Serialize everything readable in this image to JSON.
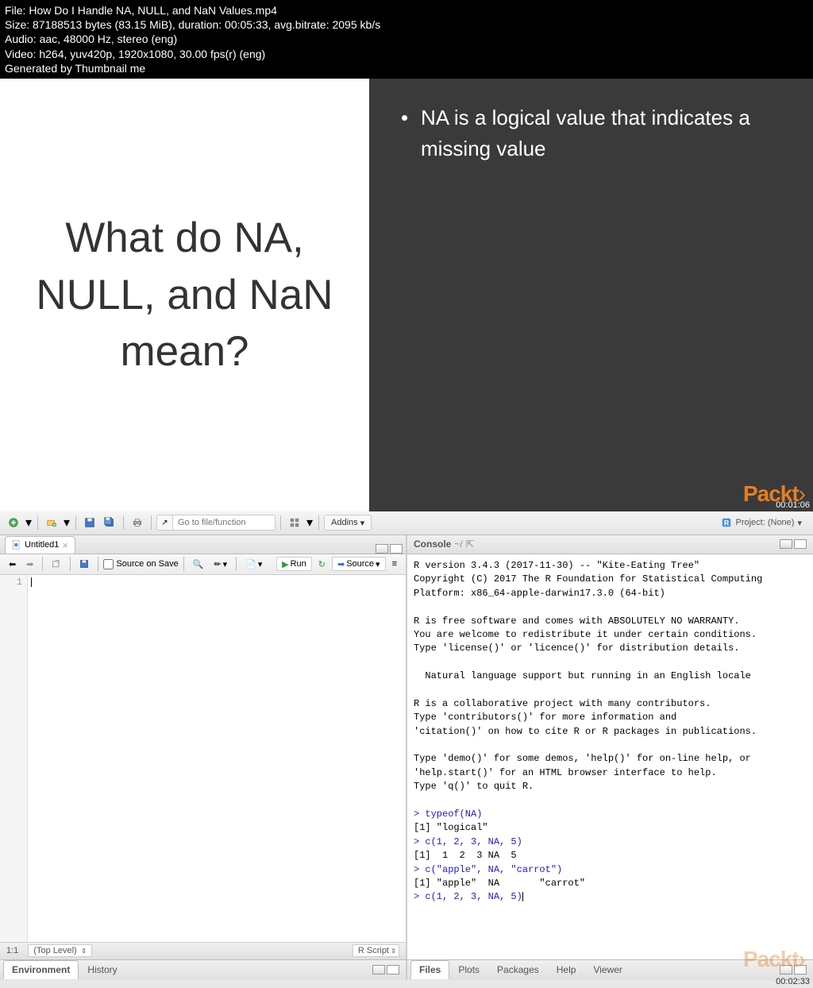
{
  "file_info": {
    "line1": "File: How Do I Handle NA, NULL, and NaN Values.mp4",
    "line2": "Size: 87188513 bytes (83.15 MiB), duration: 00:05:33, avg.bitrate: 2095 kb/s",
    "line3": "Audio: aac, 48000 Hz, stereo (eng)",
    "line4": "Video: h264, yuv420p, 1920x1080, 30.00 fps(r) (eng)",
    "line5": "Generated by Thumbnail me"
  },
  "slide": {
    "question": "What do NA, NULL, and NaN mean?",
    "bullet1": "NA is a logical value that indicates a missing value",
    "brand": "Packt",
    "ts1": "00:01:06"
  },
  "rstudio": {
    "toolbar": {
      "goto_placeholder": "Go to file/function",
      "addins": "Addins",
      "project": "Project: (None)"
    },
    "source": {
      "tab_title": "Untitled1",
      "source_on_save": "Source on Save",
      "run": "Run",
      "source_btn": "Source",
      "line1": "1",
      "status_pos": "1:1",
      "status_scope": "(Top Level)",
      "status_lang": "R Script"
    },
    "console": {
      "title": "Console",
      "path": "~/",
      "text_block1": "R version 3.4.3 (2017-11-30) -- \"Kite-Eating Tree\"\nCopyright (C) 2017 The R Foundation for Statistical Computing\nPlatform: x86_64-apple-darwin17.3.0 (64-bit)\n\nR is free software and comes with ABSOLUTELY NO WARRANTY.\nYou are welcome to redistribute it under certain conditions.\nType 'license()' or 'licence()' for distribution details.\n\n  Natural language support but running in an English locale\n\nR is a collaborative project with many contributors.\nType 'contributors()' for more information and\n'citation()' on how to cite R or R packages in publications.\n\nType 'demo()' for some demos, 'help()' for on-line help, or\n'help.start()' for an HTML browser interface to help.\nType 'q()' to quit R.\n",
      "cmd1": "> typeof(NA)",
      "out1": "[1] \"logical\"",
      "cmd2": "> c(1, 2, 3, NA, 5)",
      "out2": "[1]  1  2  3 NA  5",
      "cmd3": "> c(\"apple\", NA, \"carrot\")",
      "out3": "[1] \"apple\"  NA       \"carrot\"",
      "cmd4": "> c(1, 2, 3, NA, 5)"
    },
    "bottom_left": {
      "tab1": "Environment",
      "tab2": "History"
    },
    "bottom_right": {
      "tab1": "Files",
      "tab2": "Plots",
      "tab3": "Packages",
      "tab4": "Help",
      "tab5": "Viewer"
    },
    "brand2": "Packt",
    "ts2": "00:02:33"
  }
}
